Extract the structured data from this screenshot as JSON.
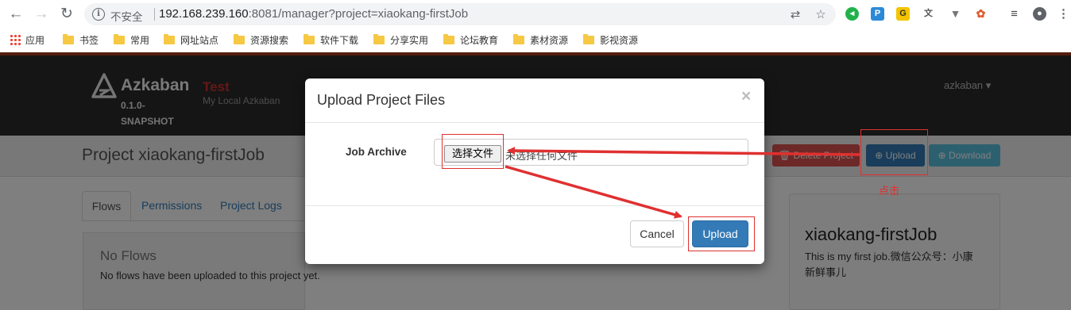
{
  "browser": {
    "security_label": "不安全",
    "url_host": "192.168.239.160",
    "url_rest": ":8081/manager?project=xiaokang-firstJob",
    "bookmarks": [
      "应用",
      "书签",
      "常用",
      "网址站点",
      "资源搜索",
      "软件下载",
      "分享实用",
      "论坛教育",
      "素材资源",
      "影视资源"
    ]
  },
  "header": {
    "brand": "Azkaban",
    "version": "0.1.0-SNAPSHOT",
    "env_name": "Test",
    "env_desc": "My Local Azkaban",
    "user": "azkaban ▾"
  },
  "project": {
    "title": "Project xiaokang-firstJob",
    "delete_label": "Delete Project",
    "upload_label": "Upload",
    "download_label": "Download"
  },
  "tabs": [
    "Flows",
    "Permissions",
    "Project Logs"
  ],
  "flows": {
    "title": "No Flows",
    "message": "No flows have been uploaded to this project yet."
  },
  "info": {
    "name": "xiaokang-firstJob",
    "description": "This is my first job.微信公众号：小康新鲜事儿"
  },
  "modal": {
    "title": "Upload Project Files",
    "close": "×",
    "field_label": "Job Archive",
    "choose_file": "选择文件",
    "file_status": "未选择任何文件",
    "cancel": "Cancel",
    "upload": "Upload"
  },
  "annotation": {
    "click_label": "点击",
    "color": "#e03030"
  },
  "colors": {
    "primary": "#337ab7",
    "danger": "#d9534f",
    "info": "#5bc0de",
    "header_bg": "#2a2a2a",
    "accent_line": "#a93b1f"
  }
}
